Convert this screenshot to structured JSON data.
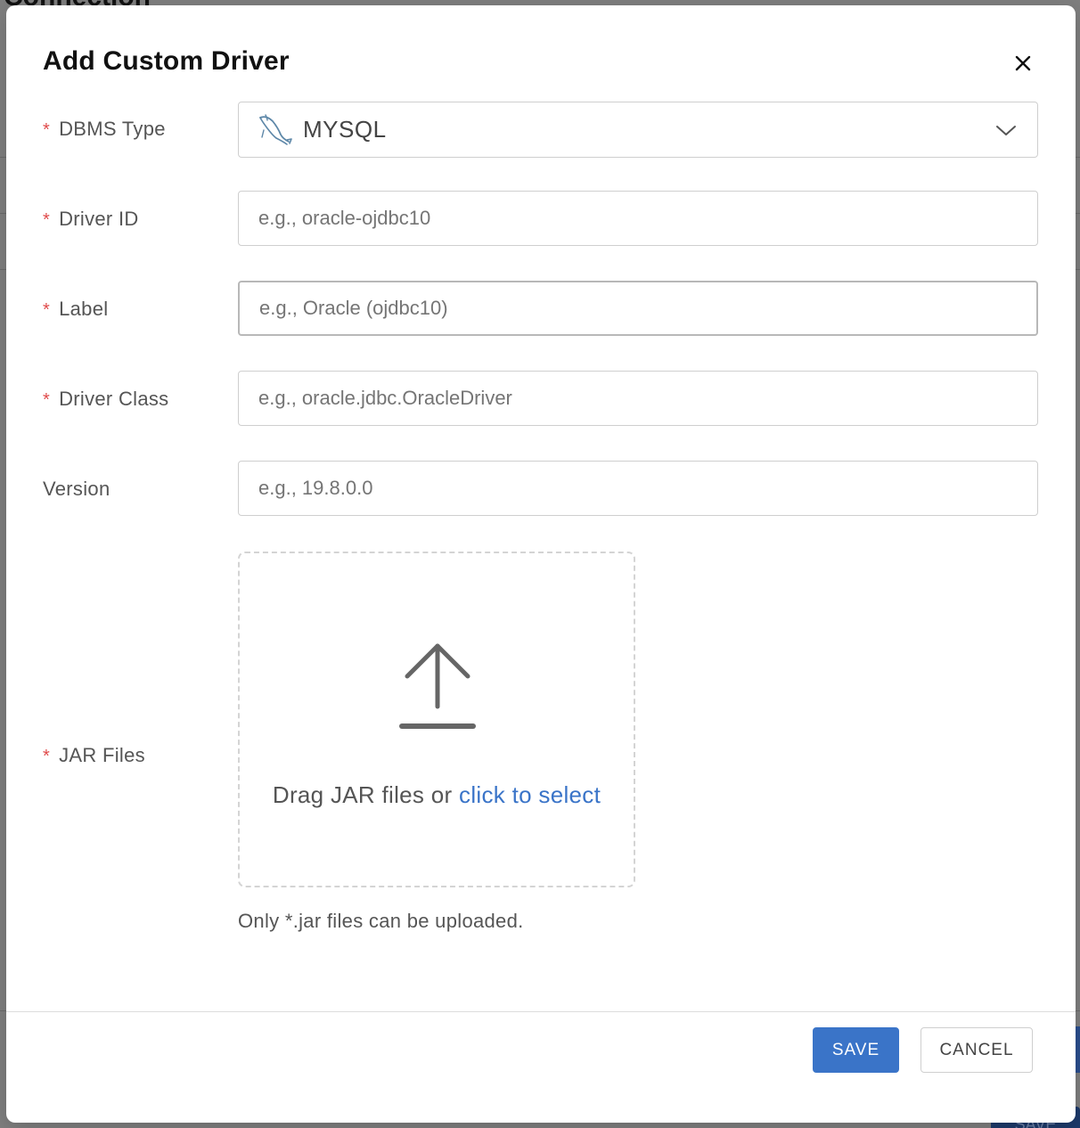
{
  "background": {
    "title": "Connection",
    "save_label": "SAVE"
  },
  "dialog": {
    "title": "Add Custom Driver",
    "close_icon": "close-icon"
  },
  "form": {
    "required_marker": "*",
    "dbms_type": {
      "label": "DBMS Type",
      "required": true,
      "value": "MYSQL",
      "icon": "mysql-dolphin-icon"
    },
    "driver_id": {
      "label": "Driver ID",
      "required": true,
      "value": "",
      "placeholder": "e.g., oracle-ojdbc10"
    },
    "label_field": {
      "label": "Label",
      "required": true,
      "value": "",
      "placeholder": "e.g., Oracle (ojdbc10)"
    },
    "driver_class": {
      "label": "Driver Class",
      "required": true,
      "value": "",
      "placeholder": "e.g., oracle.jdbc.OracleDriver"
    },
    "version": {
      "label": "Version",
      "required": false,
      "value": "",
      "placeholder": "e.g., 19.8.0.0"
    },
    "jar_files": {
      "label": "JAR Files",
      "required": true,
      "drop_text": "Drag JAR files or",
      "select_link": "click to select",
      "hint": "Only *.jar files can be uploaded."
    }
  },
  "footer": {
    "save_label": "SAVE",
    "cancel_label": "CANCEL"
  },
  "colors": {
    "accent": "#3a74c8",
    "required": "#e04b4b"
  }
}
